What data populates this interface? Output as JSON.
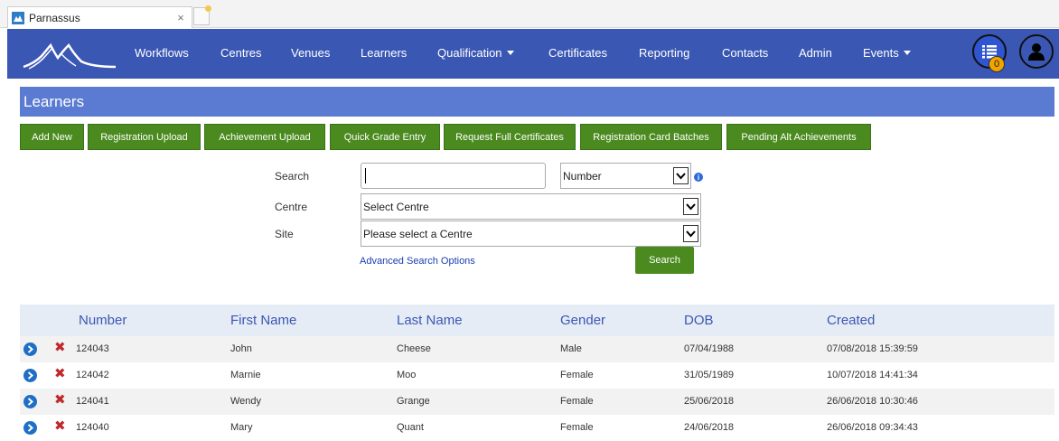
{
  "browser": {
    "tab_title": "Parnassus",
    "tab_close": "×"
  },
  "nav": {
    "items": [
      {
        "label": "Workflows"
      },
      {
        "label": "Centres"
      },
      {
        "label": "Venues"
      },
      {
        "label": "Learners"
      },
      {
        "label": "Qualification"
      },
      {
        "label": "Certificates"
      },
      {
        "label": "Reporting"
      },
      {
        "label": "Contacts"
      },
      {
        "label": "Admin"
      },
      {
        "label": "Events"
      }
    ],
    "notification_count": "0"
  },
  "page": {
    "title": "Learners"
  },
  "actions": [
    {
      "label": "Add New"
    },
    {
      "label": "Registration Upload"
    },
    {
      "label": "Achievement Upload"
    },
    {
      "label": "Quick Grade Entry"
    },
    {
      "label": "Request Full Certificates"
    },
    {
      "label": "Registration Card Batches"
    },
    {
      "label": "Pending Alt Achievements"
    }
  ],
  "search": {
    "search_label": "Search",
    "search_value": "",
    "type_select_value": "Number",
    "centre_label": "Centre",
    "centre_value": "Select Centre",
    "site_label": "Site",
    "site_value": "Please select a Centre",
    "advanced_link": "Advanced Search Options",
    "search_button": "Search"
  },
  "table": {
    "headers": [
      "Number",
      "First Name",
      "Last Name",
      "Gender",
      "DOB",
      "Created"
    ],
    "rows": [
      [
        "124043",
        "John",
        "Cheese",
        "Male",
        "07/04/1988",
        "07/08/2018 15:39:59"
      ],
      [
        "124042",
        "Marnie",
        "Moo",
        "Female",
        "31/05/1989",
        "10/07/2018 14:41:34"
      ],
      [
        "124041",
        "Wendy",
        "Grange",
        "Female",
        "25/06/2018",
        "26/06/2018 10:30:46"
      ],
      [
        "124040",
        "Mary",
        "Quant",
        "Female",
        "24/06/2018",
        "26/06/2018 09:34:43"
      ]
    ]
  },
  "colors": {
    "navbar": "#3a57b4",
    "header": "#5a7bd1",
    "button_green": "#4a8a1f",
    "delete_red": "#c0282d",
    "go_blue": "#1e6fc5"
  }
}
